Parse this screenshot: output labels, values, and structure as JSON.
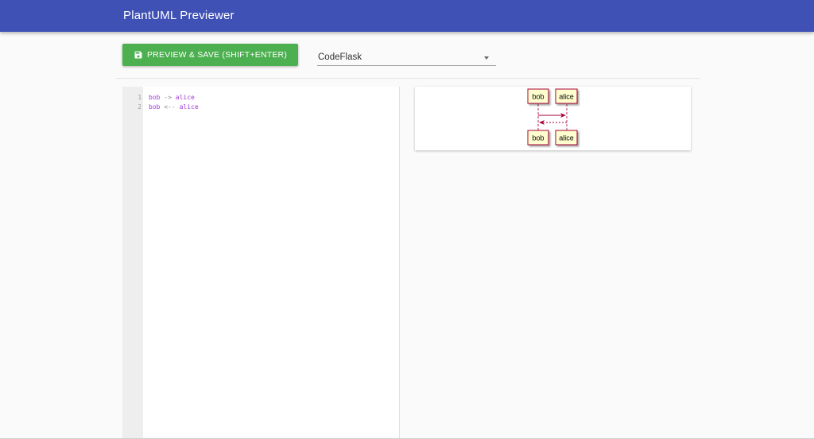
{
  "app": {
    "title": "PlantUML Previewer"
  },
  "toolbar": {
    "preview_save_label": "PREVIEW & SAVE (SHIFT+ENTER)",
    "editor_select": {
      "selected": "CodeFlask"
    }
  },
  "editor": {
    "lines": [
      {
        "number": "1",
        "from": "bob",
        "arrow": "->",
        "to": "alice"
      },
      {
        "number": "2",
        "from": "bob",
        "arrow": "<--",
        "to": "alice"
      }
    ]
  },
  "diagram": {
    "participants": [
      "bob",
      "alice"
    ],
    "messages": [
      {
        "from": "bob",
        "to": "alice",
        "style": "solid"
      },
      {
        "from": "alice",
        "to": "bob",
        "style": "dotted"
      }
    ]
  },
  "colors": {
    "app_bar": "#3f51b5",
    "primary_button": "#4caf50",
    "participant_fill": "#fefece",
    "participant_border": "#a80036",
    "keyword": "#a33ad6"
  },
  "icons": {
    "save_button_icon": "floppy-disk-icon",
    "select_icon": "triangle-down-icon"
  }
}
